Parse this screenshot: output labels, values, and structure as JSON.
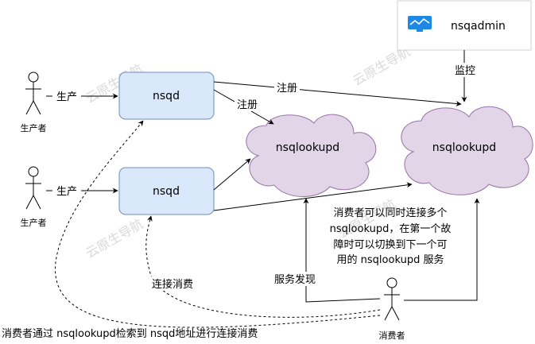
{
  "watermark": "云原生导航",
  "actors": {
    "producer_1": "生产者",
    "producer_2": "生产者",
    "consumer": "消费者"
  },
  "nodes": {
    "nsqd_1": "nsqd",
    "nsqd_2": "nsqd",
    "lookup_1": "nsqlookupd",
    "lookup_2": "nsqlookupd",
    "nsqadmin": "nsqadmin"
  },
  "edges": {
    "produce_1": "生产",
    "produce_2": "生产",
    "register_1": "注册",
    "register_2": "注册",
    "monitor": "监控",
    "connect_consume": "连接消费",
    "service_discovery": "服务发现"
  },
  "notes": {
    "failover": [
      "消费者可以同时连接多个",
      "nsqlookupd，在第一个故",
      "障时可以切换到下一个可",
      "用的 nsqlookupd 服务"
    ],
    "bottom": "消费者通过 nsqlookupd检索到 nsqd地址进行连接消费"
  },
  "colors": {
    "nsqd_fill": "#dae8fc",
    "nsqd_stroke": "#6c8ebf",
    "cloud_fill": "#e1d5e7",
    "cloud_stroke": "#9673a6",
    "admin_icon": "#1e88e5"
  }
}
